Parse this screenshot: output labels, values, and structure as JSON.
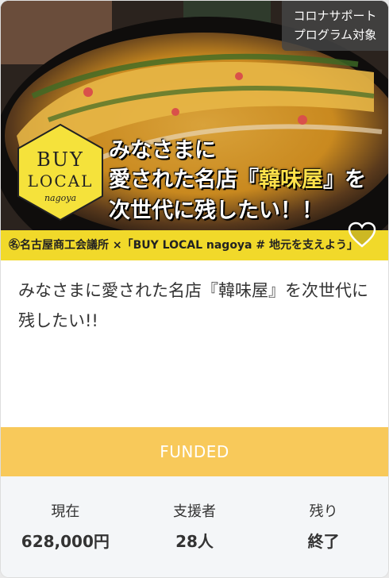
{
  "badge": {
    "line1": "コロナサポート",
    "line2": "プログラム対象"
  },
  "banner": {
    "logo_line1": "BUY",
    "logo_line2": "LOCAL",
    "logo_line3": "nagoya",
    "headline_line1": "みなさまに",
    "headline_line2_pre": "愛された名店『",
    "headline_line2_hl": "韓味屋",
    "headline_line2_post": "』を",
    "headline_line3": "次世代に残したい！！",
    "sponsor": "㊔名古屋商工会議所 ×「BUY LOCAL nagoya # 地元を支えよう」"
  },
  "favorite_icon": "heart-outline-icon",
  "title": "みなさまに愛された名店『韓味屋』を次世代に残したい!!",
  "status": "FUNDED",
  "stats": [
    {
      "label": "現在",
      "value": "628,000円"
    },
    {
      "label": "支援者",
      "value": "28人"
    },
    {
      "label": "残り",
      "value": "終了"
    }
  ],
  "colors": {
    "status_bg": "#f8c95a",
    "sponsor_bg": "#f1d92a",
    "stats_bg": "#f4f6f8"
  }
}
